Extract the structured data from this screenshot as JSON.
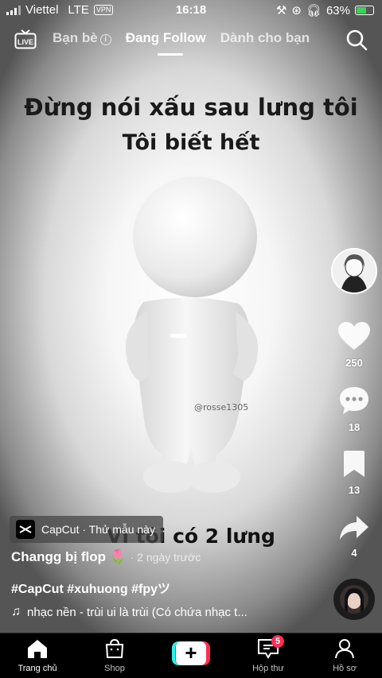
{
  "status_bar": {
    "carrier": "Viettel",
    "network": "LTE",
    "vpn": "VPN",
    "time": "16:18",
    "battery": "63%",
    "battery_level": 0.63
  },
  "top_nav": {
    "live_label": "LIVE",
    "tabs": [
      {
        "label": "Bạn bè",
        "active": false
      },
      {
        "label": "Đang Follow",
        "active": true
      },
      {
        "label": "Dành cho bạn",
        "active": false
      }
    ]
  },
  "video": {
    "caption_line1": "Đừng nói xấu sau lưng tôi",
    "caption_line2": "Tôi biết hết",
    "caption_line3": "Vì tôi có 2 lưng",
    "watermark": "@rosse1305"
  },
  "actions": {
    "likes": "250",
    "comments": "18",
    "saves": "13",
    "shares": "4"
  },
  "post": {
    "capcut_tag": "CapCut · Thử mẫu này",
    "author": "Changg bị flop 🌷",
    "time_ago": "· 2 ngày trước",
    "hashtags": "#CapCut #xuhuong #fpyツ",
    "music": "nhạc nền - trùi ui là trùi (Có chứa nhạc t..."
  },
  "bottom_nav": {
    "items": [
      {
        "label": "Trang chủ",
        "icon": "home-icon",
        "active": true
      },
      {
        "label": "Shop",
        "icon": "shop-icon",
        "active": false
      },
      {
        "label": "",
        "icon": "create-icon",
        "active": false
      },
      {
        "label": "Hộp thư",
        "icon": "inbox-icon",
        "active": false,
        "badge": "5"
      },
      {
        "label": "Hồ sơ",
        "icon": "profile-icon",
        "active": false
      }
    ]
  },
  "colors": {
    "accent_red": "#fe2c55",
    "accent_cyan": "#25f4ee",
    "battery_green": "#3ad25a"
  }
}
